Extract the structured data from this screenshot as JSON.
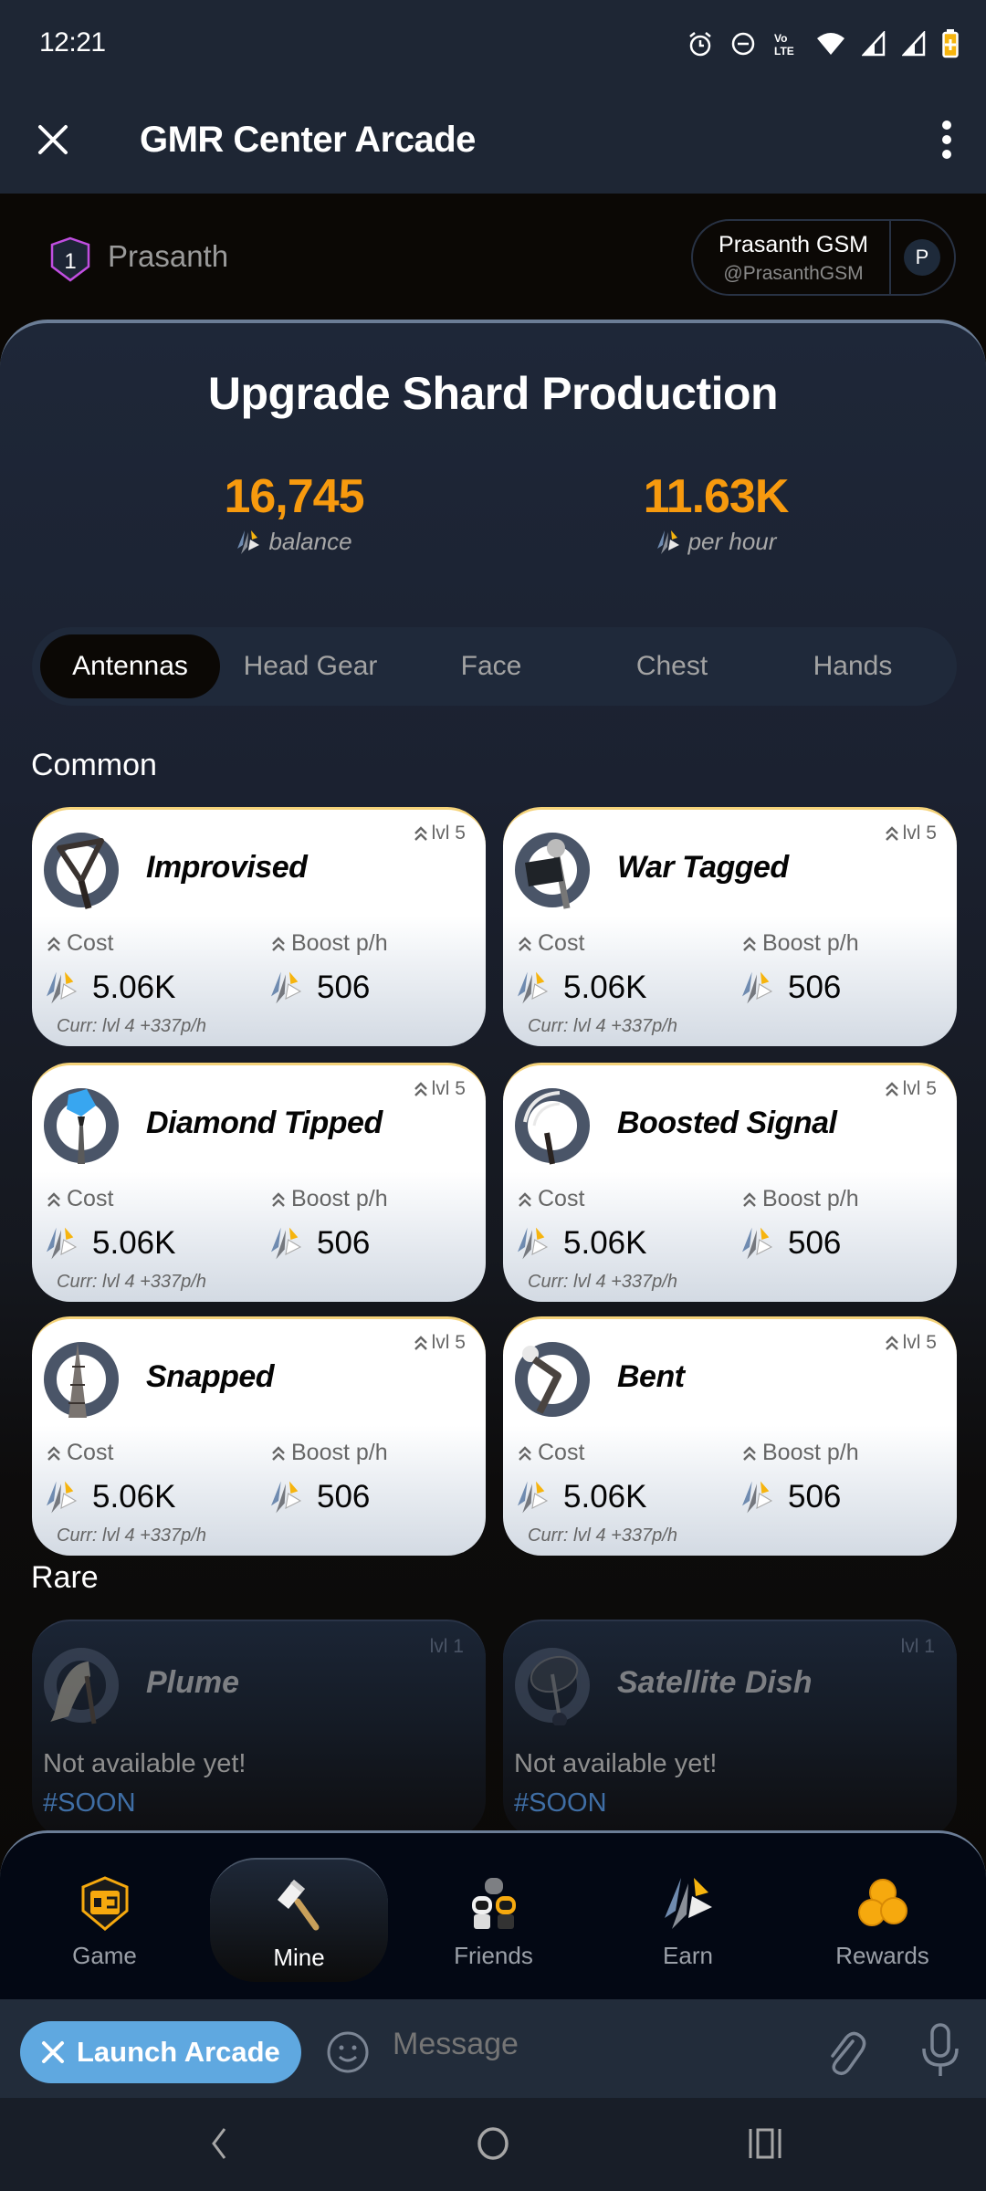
{
  "status_bar": {
    "time": "12:21",
    "icons": [
      "alarm-icon",
      "dnd-icon",
      "volte-icon",
      "wifi-icon",
      "signal-icon",
      "signal-icon",
      "battery-charging-icon"
    ]
  },
  "app_bar": {
    "title": "GMR Center Arcade",
    "close_icon": "close-icon",
    "menu_icon": "more-vertical-icon"
  },
  "user": {
    "level": "1",
    "display_name": "Prasanth",
    "profile_name": "Prasanth GSM",
    "profile_handle": "@PrasanthGSM",
    "avatar_initial": "P"
  },
  "main": {
    "title": "Upgrade Shard Production",
    "balance": {
      "value": "16,745",
      "label": "balance"
    },
    "per_hour": {
      "value": "11.63K",
      "label": "per hour"
    },
    "tabs": [
      {
        "label": "Antennas",
        "active": true
      },
      {
        "label": "Head Gear",
        "active": false
      },
      {
        "label": "Face",
        "active": false
      },
      {
        "label": "Chest",
        "active": false
      },
      {
        "label": "Hands",
        "active": false
      }
    ],
    "common_label": "Common",
    "rare_label": "Rare",
    "common_items": [
      {
        "name": "Improvised",
        "level": "lvl 5",
        "cost_label": "Cost",
        "boost_label": "Boost p/h",
        "cost": "5.06K",
        "boost": "506",
        "current": "Curr: lvl 4 +337p/h",
        "art": "triangle-antenna"
      },
      {
        "name": "War Tagged",
        "level": "lvl 5",
        "cost_label": "Cost",
        "boost_label": "Boost p/h",
        "cost": "5.06K",
        "boost": "506",
        "current": "Curr: lvl 4 +337p/h",
        "art": "flag-antenna"
      },
      {
        "name": "Diamond Tipped",
        "level": "lvl 5",
        "cost_label": "Cost",
        "boost_label": "Boost p/h",
        "cost": "5.06K",
        "boost": "506",
        "current": "Curr: lvl 4 +337p/h",
        "art": "diamond-antenna"
      },
      {
        "name": "Boosted Signal",
        "level": "lvl 5",
        "cost_label": "Cost",
        "boost_label": "Boost p/h",
        "cost": "5.06K",
        "boost": "506",
        "current": "Curr: lvl 4 +337p/h",
        "art": "signal-antenna"
      },
      {
        "name": "Snapped",
        "level": "lvl 5",
        "cost_label": "Cost",
        "boost_label": "Boost p/h",
        "cost": "5.06K",
        "boost": "506",
        "current": "Curr: lvl 4 +337p/h",
        "art": "snapped-antenna"
      },
      {
        "name": "Bent",
        "level": "lvl 5",
        "cost_label": "Cost",
        "boost_label": "Boost p/h",
        "cost": "5.06K",
        "boost": "506",
        "current": "Curr: lvl 4 +337p/h",
        "art": "bent-antenna"
      }
    ],
    "rare_items": [
      {
        "name": "Plume",
        "level": "lvl 1",
        "status": "Not available yet!",
        "tag": "#SOON",
        "art": "plume-antenna"
      },
      {
        "name": "Satellite Dish",
        "level": "lvl 1",
        "status": "Not available yet!",
        "tag": "#SOON",
        "art": "satellite-dish"
      }
    ]
  },
  "bottom_nav": [
    {
      "label": "Game",
      "icon": "game-icon",
      "active": false
    },
    {
      "label": "Mine",
      "icon": "hammer-icon",
      "active": true
    },
    {
      "label": "Friends",
      "icon": "robots-icon",
      "active": false
    },
    {
      "label": "Earn",
      "icon": "shard-icon",
      "active": false
    },
    {
      "label": "Rewards",
      "icon": "coins-icon",
      "active": false
    }
  ],
  "message_bar": {
    "launch_label": "Launch Arcade",
    "placeholder": "Message"
  },
  "colors": {
    "accent_orange": "#f79a0e",
    "launch_blue": "#5fa8e0",
    "card_border_gold": "#f5d37a",
    "soon_blue": "#3f6ea5",
    "badge_purple": "#c04ee0"
  }
}
